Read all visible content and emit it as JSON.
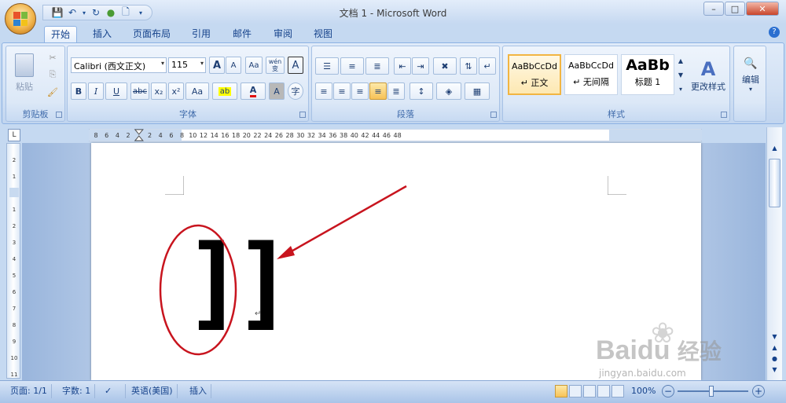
{
  "title": "文档 1 - Microsoft Word",
  "tabs": [
    "开始",
    "插入",
    "页面布局",
    "引用",
    "邮件",
    "审阅",
    "视图"
  ],
  "clipboard": {
    "paste_label": "粘贴",
    "group_label": "剪贴板"
  },
  "font": {
    "name": "Calibri (西文正文)",
    "size": "115",
    "group_label": "字体",
    "bold": "B",
    "italic": "I",
    "underline": "U",
    "strike": "abc",
    "sub": "x₂",
    "sup": "x²",
    "case": "Aa",
    "grow": "A",
    "shrink": "A",
    "clear": "Aa",
    "phonetic": "wén 变",
    "border": "A",
    "highlight": "ab",
    "fontcolor": "A",
    "shade": "A",
    "enclose": "字"
  },
  "paragraph": {
    "group_label": "段落"
  },
  "styles": {
    "group_label": "样式",
    "items": [
      {
        "preview": "AaBbCcDd",
        "name": "↵ 正文"
      },
      {
        "preview": "AaBbCcDd",
        "name": "↵ 无间隔"
      },
      {
        "preview": "AaBb",
        "name": "标题 1"
      }
    ],
    "change_label": "更改样式"
  },
  "editing": {
    "label": "编辑"
  },
  "ruler": {
    "ticks": [
      "8",
      "6",
      "4",
      "2",
      "",
      "2",
      "4",
      "6",
      "8",
      "10",
      "12",
      "14",
      "16",
      "18",
      "20",
      "22",
      "24",
      "26",
      "28",
      "30",
      "32",
      "34",
      "36",
      "38",
      "40",
      "42",
      "44",
      "46",
      "48"
    ]
  },
  "vruler": {
    "ticks": [
      "2",
      "1",
      "",
      "1",
      "2",
      "3",
      "4",
      "5",
      "6",
      "7",
      "8",
      "9",
      "10",
      "11"
    ]
  },
  "document": {
    "content": "]]",
    "paragraph_mark": "↵"
  },
  "status": {
    "page": "页面: 1/1",
    "words": "字数: 1",
    "lang": "英语(美国)",
    "mode": "插入",
    "zoom": "100%"
  },
  "watermark": {
    "brand": "Bai",
    "brand2": "du",
    "cn": "经验",
    "url": "jingyan.baidu.com"
  },
  "colors": {
    "accent": "#15428b",
    "annotation": "#c8141e",
    "highlight": "#ffff00",
    "fontcolor": "#e01010"
  }
}
